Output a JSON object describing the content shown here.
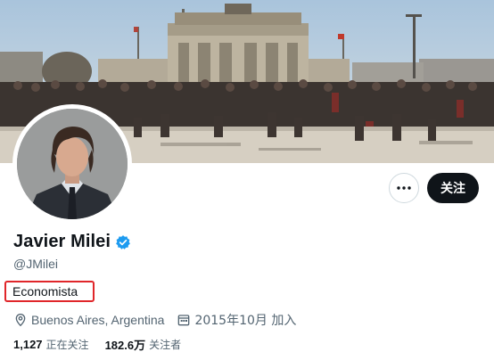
{
  "profile": {
    "name": "Javier Milei",
    "handle": "@JMilei",
    "bio": "Economista",
    "location": "Buenos Aires, Argentina",
    "joined": "2015年10月 加入",
    "following_count": "1,127",
    "following_label": "正在关注",
    "followers_count": "182.6万",
    "followers_label": "关注者"
  },
  "actions": {
    "follow_label": "关注",
    "more_icon": "more-horizontal-icon"
  },
  "colors": {
    "follow_bg": "#0f1419",
    "verified": "#1d9bf0",
    "secondary_text": "#536471",
    "highlight_box": "#e0262a"
  },
  "icons": {
    "verified": "verified-badge-icon",
    "location": "location-pin-icon",
    "calendar": "calendar-icon"
  }
}
